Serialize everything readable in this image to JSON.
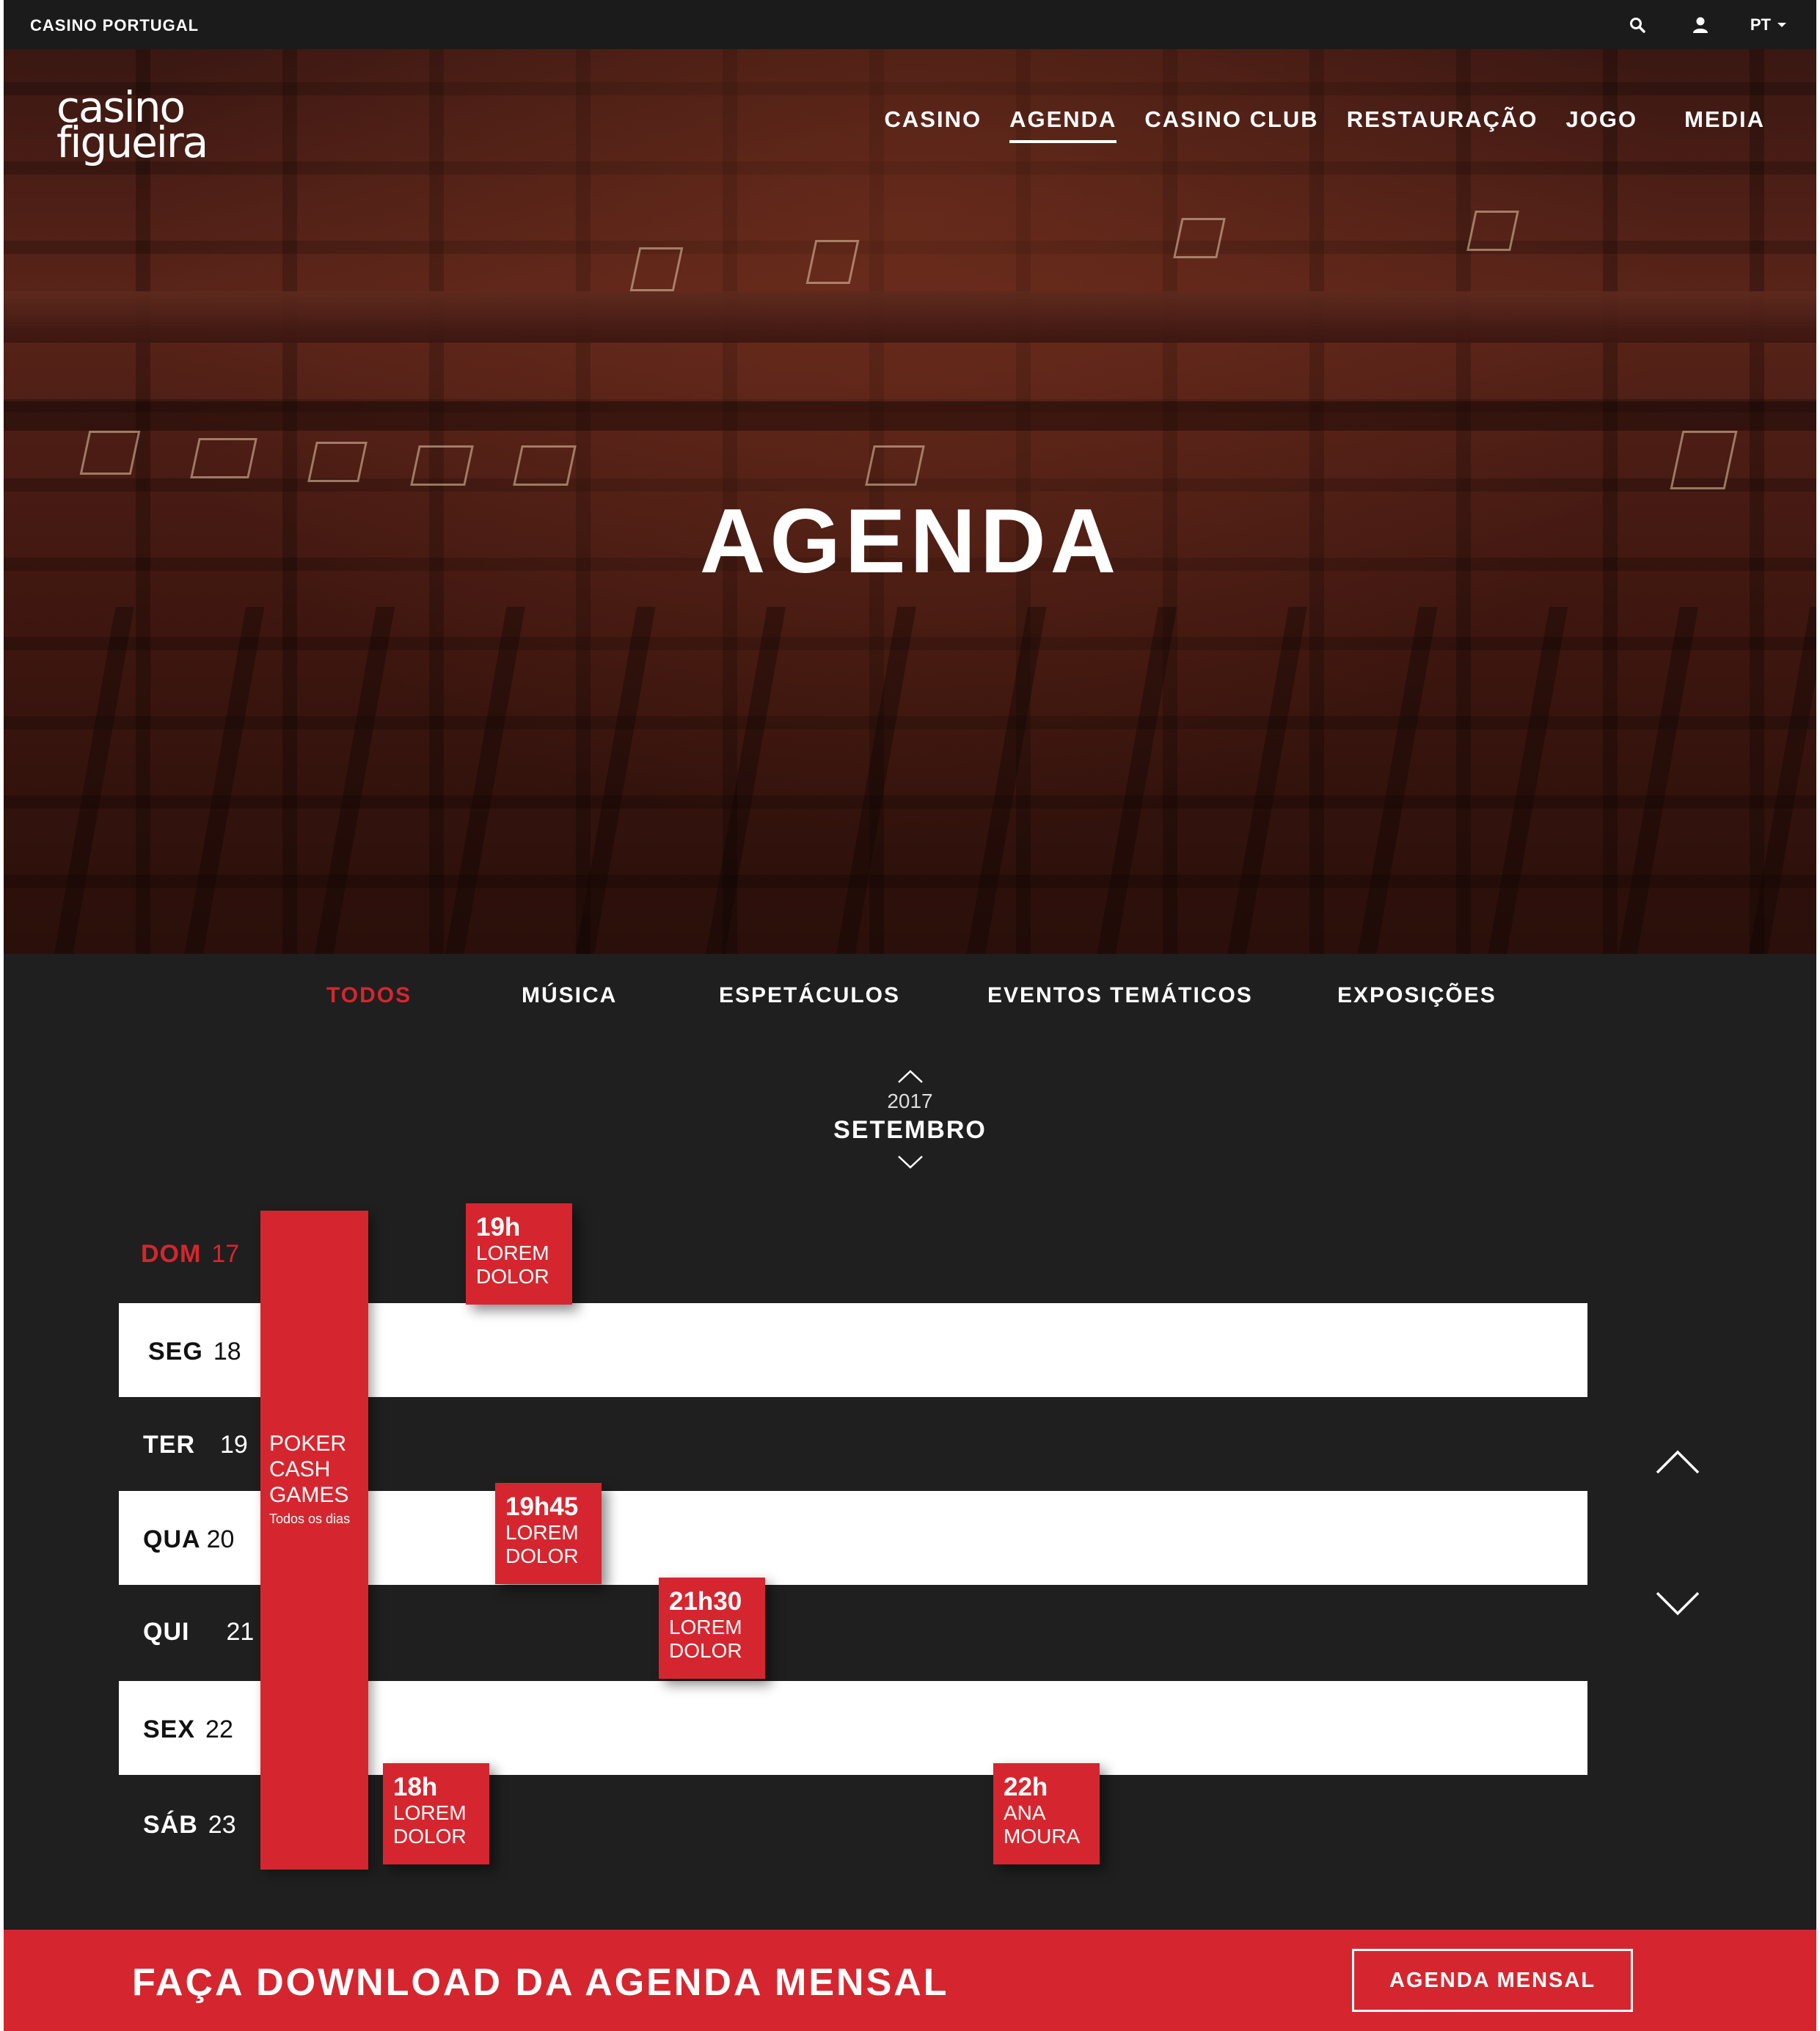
{
  "topbar": {
    "brand": "CASINO PORTUGAL",
    "lang": "PT"
  },
  "logo": {
    "line1": "casino",
    "line2": "figueira"
  },
  "nav": {
    "items": [
      "CASINO",
      "AGENDA",
      "CASINO CLUB",
      "RESTAURAÇÃO",
      "JOGO",
      "MEDIA"
    ],
    "active": "AGENDA"
  },
  "hero": {
    "title": "AGENDA"
  },
  "categories": {
    "items": [
      "TODOS",
      "MÚSICA",
      "ESPETÁCULOS",
      "EVENTOS TEMÁTICOS",
      "EXPOSIÇÕES"
    ],
    "active": "TODOS"
  },
  "month": {
    "year": "2017",
    "name": "SETEMBRO"
  },
  "days": [
    {
      "name": "DOM",
      "num": "17"
    },
    {
      "name": "SEG",
      "num": "18"
    },
    {
      "name": "TER",
      "num": "19"
    },
    {
      "name": "QUA",
      "num": "20"
    },
    {
      "name": "QUI",
      "num": "21"
    },
    {
      "name": "SEX",
      "num": "22"
    },
    {
      "name": "SÁB",
      "num": "23"
    }
  ],
  "poker": {
    "title": "POKER CASH GAMES",
    "subtitle": "Todos os dias"
  },
  "events": [
    {
      "time": "19h",
      "title": "LOREM DOLOR"
    },
    {
      "time": "19h45",
      "title": "LOREM DOLOR"
    },
    {
      "time": "21h30",
      "title": "LOREM DOLOR"
    },
    {
      "time": "18h",
      "title": "LOREM DOLOR"
    },
    {
      "time": "22h",
      "title": "ANA MOURA"
    }
  ],
  "download": {
    "text": "FAÇA DOWNLOAD DA AGENDA MENSAL",
    "button": "AGENDA MENSAL"
  },
  "colors": {
    "accent": "#d5262f",
    "dark": "#1f1f1f",
    "white": "#ffffff"
  },
  "icons": [
    "search-icon",
    "user-icon",
    "caret-down-icon",
    "chevron-up-icon",
    "chevron-down-icon"
  ]
}
